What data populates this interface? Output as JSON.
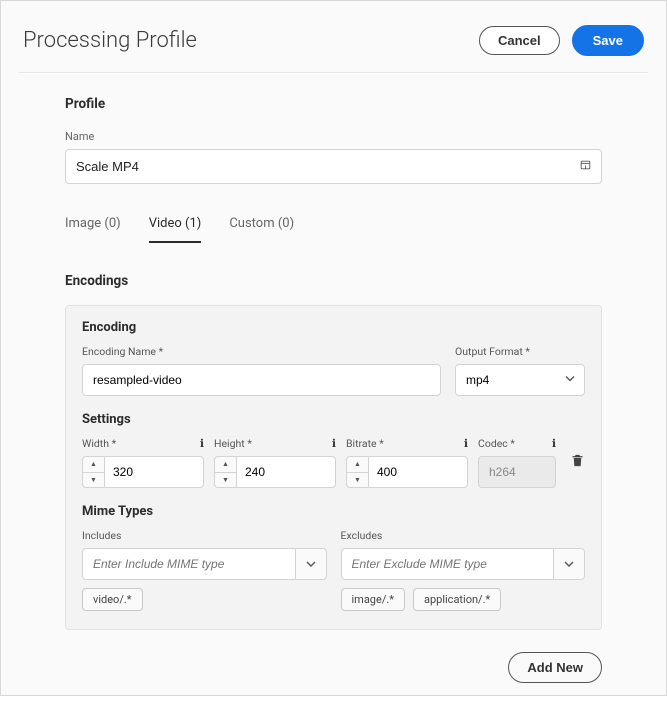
{
  "header": {
    "title": "Processing Profile",
    "cancel": "Cancel",
    "save": "Save"
  },
  "profile": {
    "heading": "Profile",
    "nameLabel": "Name",
    "nameValue": "Scale MP4"
  },
  "tabs": [
    {
      "label": "Image (0)",
      "active": false
    },
    {
      "label": "Video (1)",
      "active": true
    },
    {
      "label": "Custom (0)",
      "active": false
    }
  ],
  "encodings": {
    "heading": "Encodings",
    "block": {
      "encodingHeading": "Encoding",
      "encodingNameLabel": "Encoding Name *",
      "encodingNameValue": "resampled-video",
      "outputFormatLabel": "Output Format *",
      "outputFormatValue": "mp4",
      "settingsHeading": "Settings",
      "width": {
        "label": "Width *",
        "value": "320"
      },
      "height": {
        "label": "Height *",
        "value": "240"
      },
      "bitrate": {
        "label": "Bitrate *",
        "value": "400"
      },
      "codec": {
        "label": "Codec *",
        "value": "h264"
      },
      "mimeHeading": "Mime Types",
      "includes": {
        "label": "Includes",
        "placeholder": "Enter Include MIME type",
        "tags": [
          "video/.*"
        ]
      },
      "excludes": {
        "label": "Excludes",
        "placeholder": "Enter Exclude MIME type",
        "tags": [
          "image/.*",
          "application/.*"
        ]
      }
    },
    "addNew": "Add New"
  }
}
